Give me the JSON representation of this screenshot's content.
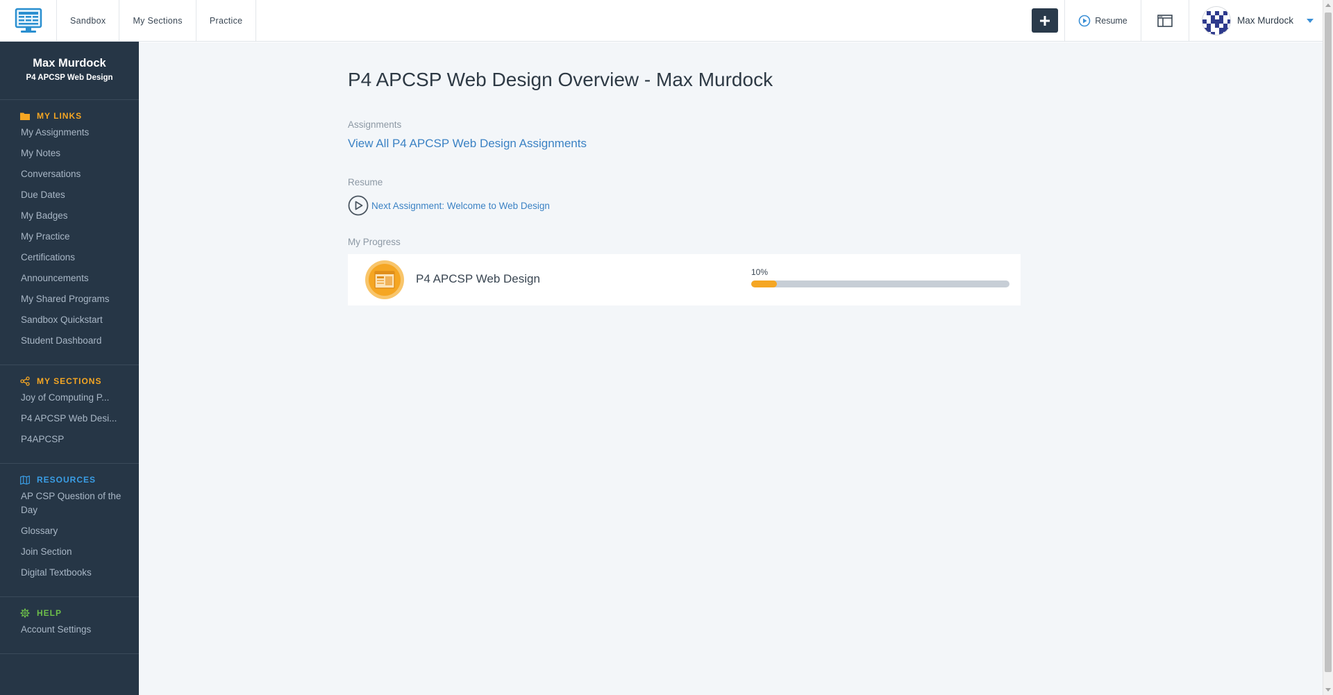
{
  "topnav": {
    "links": [
      "Sandbox",
      "My Sections",
      "Practice"
    ],
    "resume_label": "Resume",
    "user_name": "Max Murdock",
    "colors": {
      "plus_button": "#2a3a4b",
      "accent": "#3a8fd6"
    }
  },
  "sidebar": {
    "user_name": "Max Murdock",
    "course": "P4 APCSP Web Design",
    "my_links": {
      "title": "MY LINKS",
      "icon": "folder-icon",
      "items": [
        "My Assignments",
        "My Notes",
        "Conversations",
        "Due Dates",
        "My Badges",
        "My Practice",
        "Certifications",
        "Announcements",
        "My Shared Programs",
        "Sandbox Quickstart",
        "Student Dashboard"
      ]
    },
    "my_sections": {
      "title": "MY SECTIONS",
      "icon": "share-icon",
      "items": [
        "Joy of Computing P...",
        "P4 APCSP Web Desi...",
        "P4APCSP"
      ]
    },
    "resources": {
      "title": "RESOURCES",
      "icon": "map-icon",
      "items": [
        "AP CSP Question of the Day",
        "Glossary",
        "Join Section",
        "Digital Textbooks"
      ]
    },
    "help": {
      "title": "HELP",
      "icon": "gear-icon",
      "items": [
        "Account Settings"
      ]
    }
  },
  "main": {
    "title": "P4 APCSP Web Design Overview - Max Murdock",
    "assignments_label": "Assignments",
    "assignments_link": "View All P4 APCSP Web Design Assignments",
    "resume_label": "Resume",
    "resume_link": "Next Assignment: Welcome to Web Design",
    "progress_label": "My Progress",
    "progress": {
      "course": "P4 APCSP Web Design",
      "percent_text": "10%",
      "percent": 10
    }
  }
}
